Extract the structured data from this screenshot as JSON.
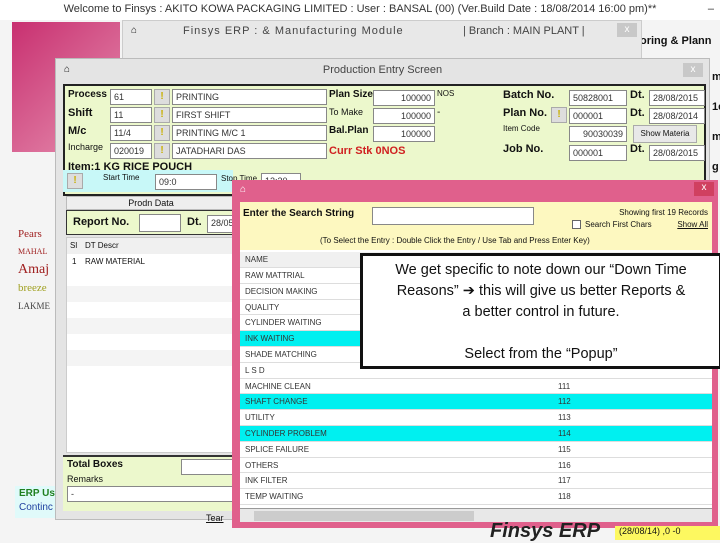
{
  "app_title": "Welcome to Finsys : AKITO KOWA PACKAGING LIMITED : User : BANSAL (00) (Ver.Build Date : 18/08/2014 16:00 pm)**",
  "erp_window": {
    "title": "Finsys ERP  :  & Manufacturing  Module",
    "branch": "| Branch : MAIN PLANT |",
    "right_label": "oring & Plann"
  },
  "right_strip": [
    "m",
    "1e",
    "m",
    "g"
  ],
  "brands": [
    "Pears",
    "MAHAL",
    "Amaj",
    "breeze",
    "LAKME"
  ],
  "production": {
    "title": "Production Entry Screen",
    "process": {
      "label": "Process",
      "code": "61",
      "name": "PRINTING"
    },
    "shift": {
      "label": "Shift",
      "code": "11",
      "name": "FIRST SHIFT"
    },
    "mc": {
      "label": "M/c",
      "code": "11/4",
      "name": "PRINTING M/C 1"
    },
    "incharge": {
      "label": "Incharge",
      "code": "020019",
      "name": "JATADHARI DAS"
    },
    "plan_size": {
      "label": "Plan Size",
      "value": "100000",
      "unit": "NOS"
    },
    "to_make": {
      "label": "To Make",
      "value": "100000",
      "unit": "-"
    },
    "bal_plan": {
      "label": "Bal.Plan",
      "value": "100000"
    },
    "curr_stk": "Curr Stk 0NOS",
    "batch_no": {
      "label": "Batch No.",
      "value": "50828001",
      "dt_label": "Dt.",
      "dt": "28/08/2015"
    },
    "plan_no": {
      "label": "Plan No.",
      "value": "000001",
      "dt_label": "Dt.",
      "dt": "28/08/2014"
    },
    "item_code": {
      "label": "Item Code",
      "value": "90030039",
      "button": "Show Materia"
    },
    "job_no": {
      "label": "Job No.",
      "value": "000001",
      "dt_label": "Dt.",
      "dt": "28/08/2015"
    },
    "item": "Item:1 KG RICE POUCH",
    "start_time": {
      "label": "Start Time",
      "value": "09:0"
    },
    "stop_time": {
      "label": "Stop Time",
      "value": "12:30"
    },
    "prodn_tab": "Prodn Data",
    "report_no": {
      "label": "Report No.",
      "value": "",
      "dt_label": "Dt.",
      "dt": "28/05"
    },
    "grid": {
      "headers": [
        "Sl",
        "DT Descr"
      ],
      "rows": [
        [
          "1",
          "RAW MATERIAL"
        ]
      ]
    },
    "total_boxes": "Total Boxes",
    "remarks": {
      "label": "Remarks",
      "value": "-"
    },
    "footer_text": "Tear"
  },
  "popup": {
    "search_label": "Enter the Search String",
    "search_value": "",
    "showing": "Showing first 19 Records",
    "search_first": "Search First Chars",
    "show_all": "Show All",
    "hint": "(To Select the Entry : Double Click the Entry / Use Tab and Press Enter Key)",
    "col_name": "NAME",
    "rows": [
      {
        "name": "RAW MATTRIAL",
        "code": ""
      },
      {
        "name": "DECISION MAKING",
        "code": ""
      },
      {
        "name": "QUALITY",
        "code": ""
      },
      {
        "name": "CYLINDER WAITING",
        "code": ""
      },
      {
        "name": "INK WAITING",
        "code": "",
        "hl": true
      },
      {
        "name": "SHADE MATCHING",
        "code": ""
      },
      {
        "name": "L S D",
        "code": ""
      },
      {
        "name": "MACHINE CLEAN",
        "code": "111"
      },
      {
        "name": "SHAFT CHANGE",
        "code": "112",
        "hl": true
      },
      {
        "name": "UTILITY",
        "code": "113"
      },
      {
        "name": "CYLINDER PROBLEM",
        "code": "114",
        "hl": true
      },
      {
        "name": "SPLICE FAILURE",
        "code": "115"
      },
      {
        "name": "OTHERS",
        "code": "116"
      },
      {
        "name": "INK FILTER",
        "code": "117"
      },
      {
        "name": "TEMP WAITING",
        "code": "118"
      }
    ]
  },
  "annotation": {
    "line1": "We get specific to note down our “Down Time",
    "line2": "Reasons” ➔ this will give us better Reports &",
    "line3": "a better control in future.",
    "line4": "Select from the “Popup”"
  },
  "left_bottom": {
    "erp_user": "ERP Us",
    "continue": "Continc"
  },
  "footer": {
    "brand": "Finsys ERP",
    "status": "(28/08/14) ,0 -0"
  }
}
